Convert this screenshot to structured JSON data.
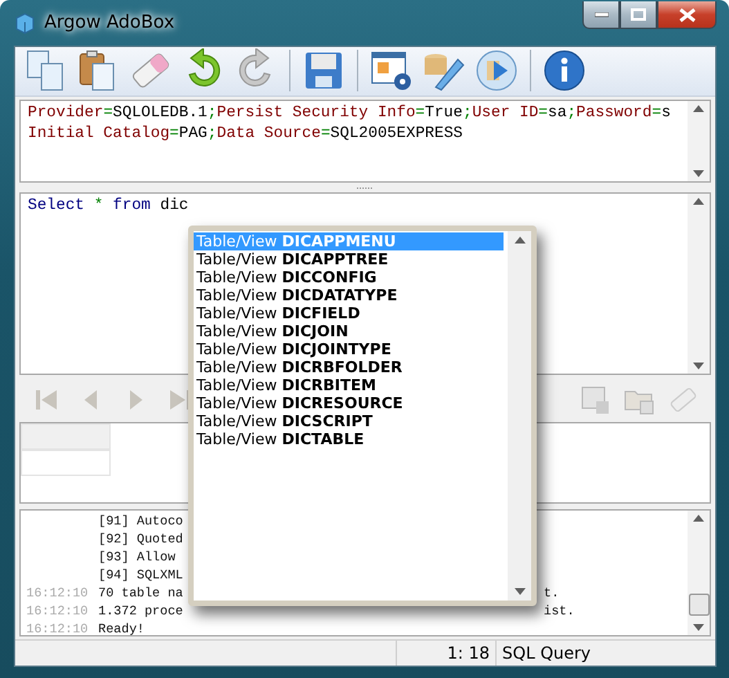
{
  "window": {
    "title": "Argow AdoBox"
  },
  "connection": {
    "lines": [
      [
        {
          "kind": "key",
          "text": "Provider"
        },
        {
          "kind": "op",
          "text": "="
        },
        {
          "kind": "value",
          "text": "SQLOLEDB.1"
        },
        {
          "kind": "op",
          "text": ";"
        },
        {
          "kind": "key",
          "text": "Persist Security Info"
        },
        {
          "kind": "op",
          "text": "="
        },
        {
          "kind": "value",
          "text": "True"
        },
        {
          "kind": "op",
          "text": ";"
        },
        {
          "kind": "key",
          "text": "User ID"
        },
        {
          "kind": "op",
          "text": "="
        },
        {
          "kind": "value",
          "text": "sa"
        },
        {
          "kind": "op",
          "text": ";"
        },
        {
          "kind": "key",
          "text": "Password"
        },
        {
          "kind": "op",
          "text": "="
        },
        {
          "kind": "value",
          "text": "s"
        }
      ],
      [
        {
          "kind": "key",
          "text": "Initial Catalog"
        },
        {
          "kind": "op",
          "text": "="
        },
        {
          "kind": "value",
          "text": "PAG"
        },
        {
          "kind": "op",
          "text": ";"
        },
        {
          "kind": "key",
          "text": "Data Source"
        },
        {
          "kind": "op",
          "text": "="
        },
        {
          "kind": "value",
          "text": "SQL2005EXPRESS"
        }
      ]
    ]
  },
  "query": {
    "tokens": [
      {
        "kind": "keyword",
        "text": "Select"
      },
      {
        "kind": "op",
        "text": "*"
      },
      {
        "kind": "keyword",
        "text": "from"
      },
      {
        "kind": "ident",
        "text": "dic"
      }
    ]
  },
  "autocomplete": {
    "items": [
      {
        "prefix": "Table/View",
        "name": "DICAPPMENU",
        "selected": true
      },
      {
        "prefix": "Table/View",
        "name": "DICAPPTREE",
        "selected": false
      },
      {
        "prefix": "Table/View",
        "name": "DICCONFIG",
        "selected": false
      },
      {
        "prefix": "Table/View",
        "name": "DICDATATYPE",
        "selected": false
      },
      {
        "prefix": "Table/View",
        "name": "DICFIELD",
        "selected": false
      },
      {
        "prefix": "Table/View",
        "name": "DICJOIN",
        "selected": false
      },
      {
        "prefix": "Table/View",
        "name": "DICJOINTYPE",
        "selected": false
      },
      {
        "prefix": "Table/View",
        "name": "DICRBFOLDER",
        "selected": false
      },
      {
        "prefix": "Table/View",
        "name": "DICRBITEM",
        "selected": false
      },
      {
        "prefix": "Table/View",
        "name": "DICRESOURCE",
        "selected": false
      },
      {
        "prefix": "Table/View",
        "name": "DICSCRIPT",
        "selected": false
      },
      {
        "prefix": "Table/View",
        "name": "DICTABLE",
        "selected": false
      }
    ]
  },
  "log": {
    "lines": [
      {
        "text": "[91] Autoco"
      },
      {
        "text": "[92] Quoted"
      },
      {
        "text": "[93] Allow"
      },
      {
        "text": "[94] SQLXML"
      },
      {
        "time": "16:12:10",
        "text": "70 table na",
        "tail": "t."
      },
      {
        "time": "16:12:10",
        "text": "1.372 proce",
        "tail": "ist."
      },
      {
        "time": "16:12:10",
        "text": "Ready!"
      }
    ]
  },
  "status_bar": {
    "position": "1: 18",
    "mode": "SQL Query"
  }
}
